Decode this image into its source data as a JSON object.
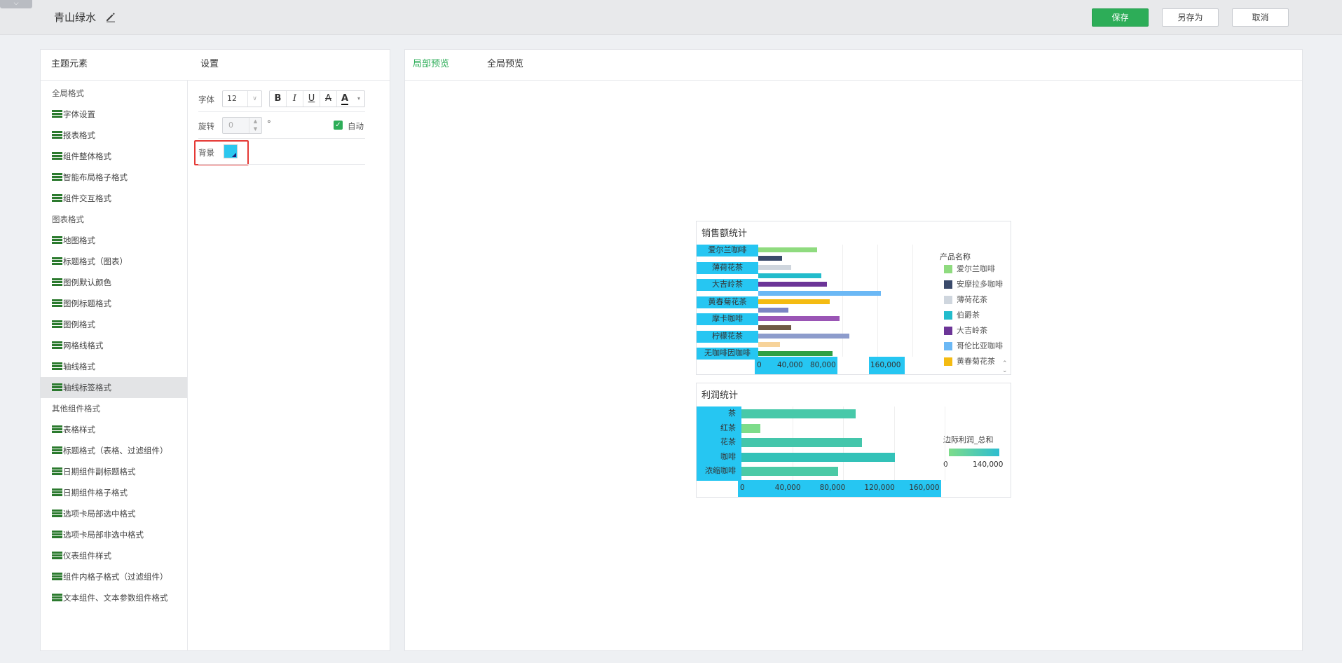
{
  "header": {
    "collapse_icon": "chevron-down-icon",
    "title": "青山绿水",
    "save_label": "保存",
    "saveas_label": "另存为",
    "cancel_label": "取消",
    "accent_color": "#2dad58"
  },
  "left_panel": {
    "theme_header": "主题元素",
    "settings_header": "设置",
    "tree": [
      {
        "label": "全局格式",
        "type": "group"
      },
      {
        "label": "字体设置",
        "type": "leaf"
      },
      {
        "label": "报表格式",
        "type": "leaf"
      },
      {
        "label": "组件整体格式",
        "type": "leaf"
      },
      {
        "label": "智能布局格子格式",
        "type": "leaf"
      },
      {
        "label": "组件交互格式",
        "type": "leaf"
      },
      {
        "label": "图表格式",
        "type": "group"
      },
      {
        "label": "地图格式",
        "type": "leaf"
      },
      {
        "label": "标题格式（图表）",
        "type": "leaf"
      },
      {
        "label": "图例默认颜色",
        "type": "leaf"
      },
      {
        "label": "图例标题格式",
        "type": "leaf"
      },
      {
        "label": "图例格式",
        "type": "leaf"
      },
      {
        "label": "网格线格式",
        "type": "leaf"
      },
      {
        "label": "轴线格式",
        "type": "leaf"
      },
      {
        "label": "轴线标签格式",
        "type": "leaf",
        "active": true
      },
      {
        "label": "其他组件格式",
        "type": "group"
      },
      {
        "label": "表格样式",
        "type": "leaf"
      },
      {
        "label": "标题格式（表格、过滤组件）",
        "type": "leaf"
      },
      {
        "label": "日期组件副标题格式",
        "type": "leaf"
      },
      {
        "label": "日期组件格子格式",
        "type": "leaf"
      },
      {
        "label": "选项卡局部选中格式",
        "type": "leaf"
      },
      {
        "label": "选项卡局部非选中格式",
        "type": "leaf"
      },
      {
        "label": "仪表组件样式",
        "type": "leaf"
      },
      {
        "label": "组件内格子格式（过滤组件）",
        "type": "leaf"
      },
      {
        "label": "文本组件、文本参数组件格式",
        "type": "leaf"
      }
    ],
    "settings": {
      "font_label": "字体",
      "font_size": "12",
      "bold": "B",
      "italic": "I",
      "underline": "U",
      "strike": "A",
      "color": "A",
      "rotate_label": "旋转",
      "rotate_value": "0",
      "degree": "°",
      "auto_label": "自动",
      "auto_checked": true,
      "bg_label": "背景",
      "bg_color": "#2bc7ef"
    }
  },
  "right_panel": {
    "tab_local": "局部预览",
    "tab_global": "全局预览"
  },
  "chart_data": [
    {
      "type": "bar",
      "orientation": "horizontal",
      "title": "销售额统计",
      "categories": [
        "爱尔兰咖啡",
        "薄荷花茶",
        "大吉岭茶",
        "黄春菊花茶",
        "摩卡咖啡",
        "柠檬花茶",
        "无咖啡因咖啡"
      ],
      "xticks": [
        "0",
        "40,000",
        "80,000",
        "160,000"
      ],
      "xlim": [
        0,
        240000
      ],
      "legend_title": "产品名称",
      "legend": [
        {
          "name": "爱尔兰咖啡",
          "color": "#8fdb7f"
        },
        {
          "name": "安摩拉多咖啡",
          "color": "#3a4a6b"
        },
        {
          "name": "薄荷花茶",
          "color": "#cfd6de"
        },
        {
          "name": "伯爵茶",
          "color": "#22bccc"
        },
        {
          "name": "大吉岭茶",
          "color": "#6c3597"
        },
        {
          "name": "哥伦比亚咖啡",
          "color": "#6bb8f5"
        },
        {
          "name": "黄春菊花茶",
          "color": "#f4bb12"
        }
      ],
      "bars": [
        {
          "value": 76000,
          "color": "#8fdb7f"
        },
        {
          "value": 31000,
          "color": "#3a4a6b"
        },
        {
          "value": 42000,
          "color": "#cfd6de"
        },
        {
          "value": 81000,
          "color": "#22bccc"
        },
        {
          "value": 88000,
          "color": "#6c3597"
        },
        {
          "value": 157000,
          "color": "#6bb8f5"
        },
        {
          "value": 92000,
          "color": "#f4bb12"
        },
        {
          "value": 39000,
          "color": "#7b84c4"
        },
        {
          "value": 104000,
          "color": "#9a55b5"
        },
        {
          "value": 42000,
          "color": "#6f5a45"
        },
        {
          "value": 117000,
          "color": "#8d9ccc"
        },
        {
          "value": 28000,
          "color": "#f7d39a"
        },
        {
          "value": 95000,
          "color": "#2ea043"
        }
      ]
    },
    {
      "type": "bar",
      "orientation": "horizontal",
      "title": "利润统计",
      "categories": [
        "茶",
        "红茶",
        "花茶",
        "咖啡",
        "浓缩咖啡"
      ],
      "values": [
        90000,
        15000,
        95000,
        121000,
        76000
      ],
      "colors": [
        "#47c9a9",
        "#7ddc8a",
        "#44c6ab",
        "#33c2b8",
        "#4ccaa6"
      ],
      "xticks": [
        "0",
        "40,000",
        "80,000",
        "120,000",
        "160,000"
      ],
      "xlim": [
        0,
        160000
      ],
      "legend_title": "边际利润_总和",
      "legend_min": "0",
      "legend_max": "140,000"
    }
  ]
}
